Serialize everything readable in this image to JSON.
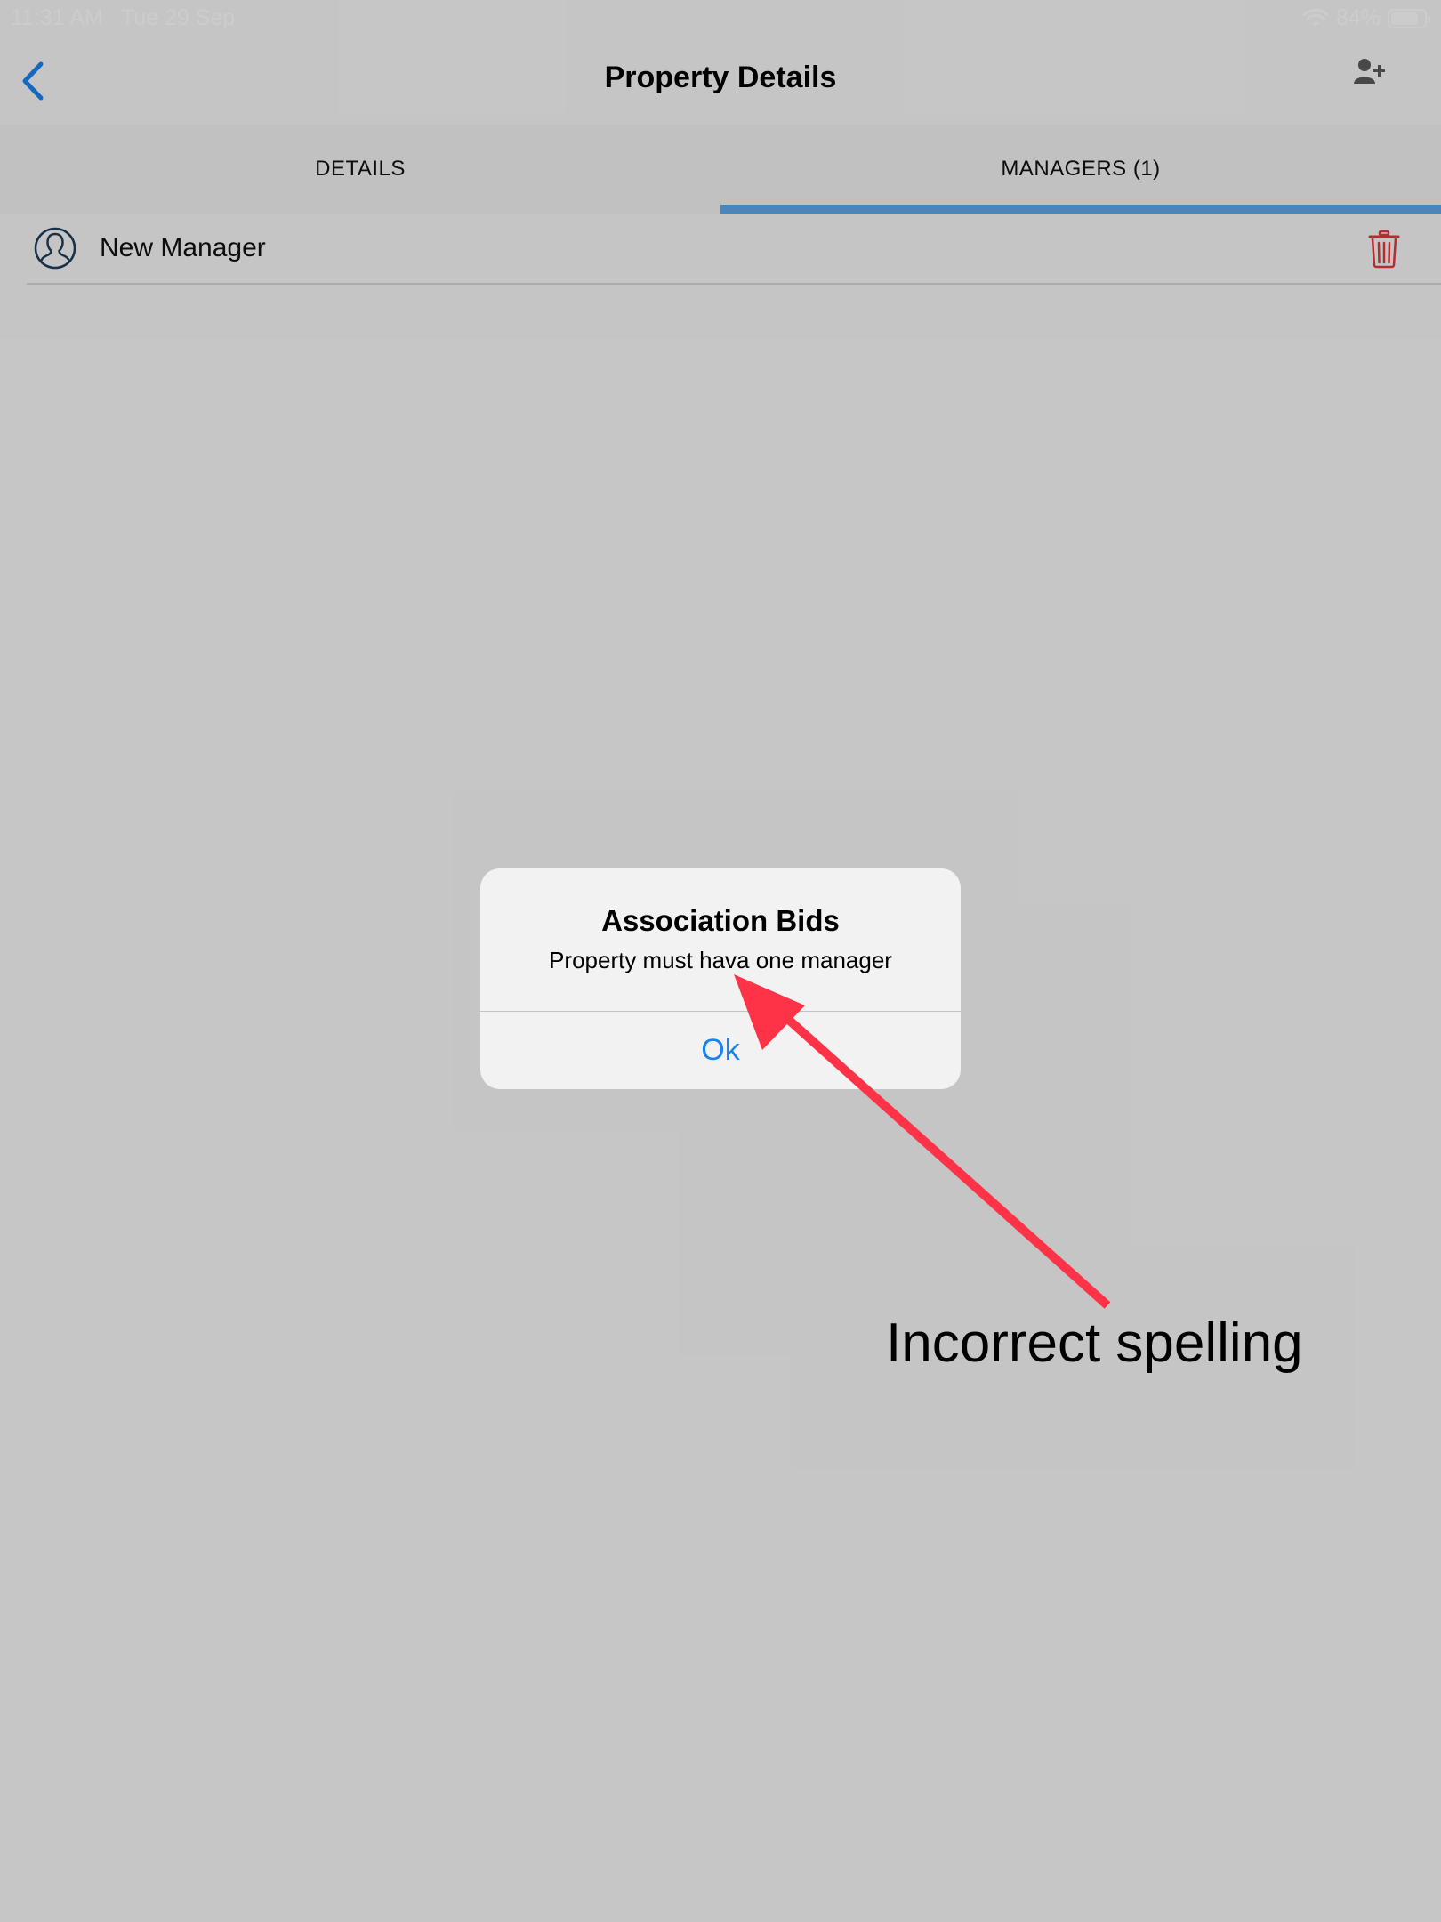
{
  "status_bar": {
    "time": "11:31 AM",
    "date": "Tue 29 Sep",
    "battery_percent": "84%",
    "battery_level": 0.84
  },
  "nav": {
    "title": "Property Details",
    "back_icon": "chevron-left-icon",
    "add_icon": "person-add-icon"
  },
  "tabs": [
    {
      "label": "DETAILS",
      "active": false
    },
    {
      "label": "MANAGERS (1)",
      "active": true
    }
  ],
  "managers": [
    {
      "name": "New Manager",
      "icon": "user-circle-icon",
      "delete_icon": "trash-icon"
    }
  ],
  "alert": {
    "title": "Association Bids",
    "message": "Property must hava one manager",
    "ok_label": "Ok"
  },
  "annotation": {
    "text": "Incorrect spelling",
    "arrow_color": "#fe3348"
  },
  "colors": {
    "accent": "#5da8ec",
    "link": "#1a82f0",
    "delete": "#e0393e",
    "avatar": "#1f3c5a"
  }
}
